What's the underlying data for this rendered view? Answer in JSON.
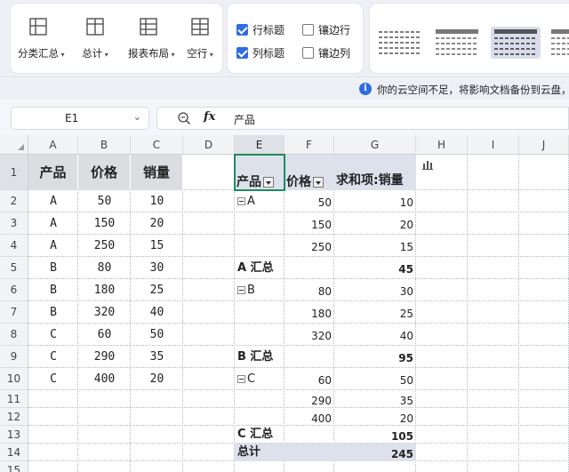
{
  "ribbon": {
    "buttons": [
      {
        "label": "分类汇总",
        "icon": "subtotal-icon"
      },
      {
        "label": "总计",
        "icon": "grand-total-icon"
      },
      {
        "label": "报表布局",
        "icon": "report-layout-icon"
      },
      {
        "label": "空行",
        "icon": "blank-rows-icon"
      }
    ],
    "checkboxes": [
      {
        "label": "行标题",
        "checked": true
      },
      {
        "label": "镶边行",
        "checked": false
      },
      {
        "label": "列标题",
        "checked": true
      },
      {
        "label": "镶边列",
        "checked": false
      }
    ]
  },
  "notice": {
    "text": "你的云空间不足，将影响文档备份到云盘，"
  },
  "formula_bar": {
    "name_box": "E1",
    "fx": "fx",
    "content": "产品"
  },
  "grid": {
    "columns": [
      "A",
      "B",
      "C",
      "D",
      "E",
      "F",
      "G",
      "H",
      "I",
      "J"
    ],
    "rows": [
      "1",
      "2",
      "3",
      "4",
      "5",
      "6",
      "7",
      "8",
      "9",
      "10",
      "11",
      "12",
      "13",
      "14",
      "15"
    ],
    "selected_cell": "E1"
  },
  "source_table": {
    "headers": [
      "产品",
      "价格",
      "销量"
    ],
    "rows": [
      [
        "A",
        "50",
        "10"
      ],
      [
        "A",
        "150",
        "20"
      ],
      [
        "A",
        "250",
        "15"
      ],
      [
        "B",
        "80",
        "30"
      ],
      [
        "B",
        "180",
        "25"
      ],
      [
        "B",
        "320",
        "40"
      ],
      [
        "C",
        "60",
        "50"
      ],
      [
        "C",
        "290",
        "35"
      ],
      [
        "C",
        "400",
        "20"
      ]
    ]
  },
  "pivot": {
    "headers": {
      "product": "产品",
      "price": "价格",
      "sum": "求和项:销量"
    },
    "rows": [
      {
        "label": "A",
        "price": "50",
        "sum": "10"
      },
      {
        "label": "",
        "price": "150",
        "sum": "20"
      },
      {
        "label": "",
        "price": "250",
        "sum": "15"
      },
      {
        "label": "A 汇总",
        "price": "",
        "sum": "45"
      },
      {
        "label": "B",
        "price": "80",
        "sum": "30"
      },
      {
        "label": "",
        "price": "180",
        "sum": "25"
      },
      {
        "label": "",
        "price": "320",
        "sum": "40"
      },
      {
        "label": "B 汇总",
        "price": "",
        "sum": "95"
      },
      {
        "label": "C",
        "price": "60",
        "sum": "50"
      },
      {
        "label": "",
        "price": "290",
        "sum": "35"
      },
      {
        "label": "",
        "price": "400",
        "sum": "20"
      },
      {
        "label": "C 汇总",
        "price": "",
        "sum": "105"
      },
      {
        "label": "总计",
        "price": "",
        "sum": "245"
      }
    ]
  }
}
